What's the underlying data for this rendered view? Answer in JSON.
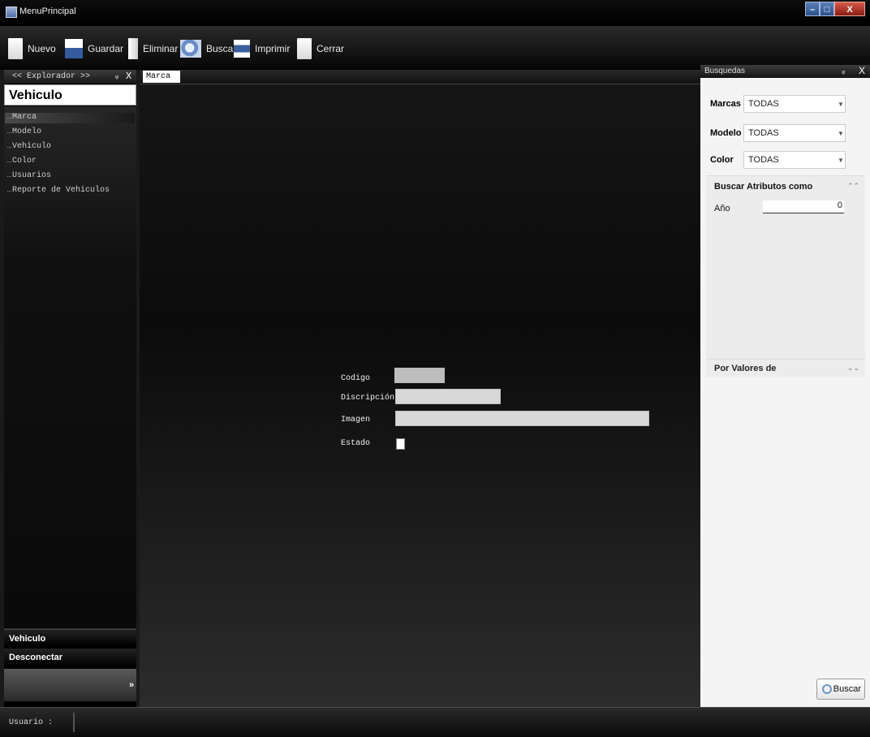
{
  "window": {
    "title": "MenuPrincipal",
    "min_label": "–",
    "max_label": "□",
    "close_label": "X"
  },
  "toolbar": {
    "nuevo": "Nuevo",
    "guardar": "Guardar",
    "eliminar": "Eliminar",
    "buscar": "Buscar",
    "imprimir": "Imprimir",
    "cerrar": "Cerrar"
  },
  "explorer": {
    "header": "<< Explorador >>",
    "pin": "ᵩ",
    "close": "X",
    "title": "Vehiculo",
    "items": [
      "Marca",
      "Modelo",
      "Vehiculo",
      "Color",
      "Usuarios",
      "Reporte de Vehiculos"
    ],
    "nav": [
      "Vehiculo",
      "Desconectar"
    ],
    "chevron": "»"
  },
  "main": {
    "tab": "Marca",
    "form": {
      "codigo_label": "Codigo",
      "descripcion_label": "Discripción",
      "imagen_label": "Imagen",
      "estado_label": "Estado",
      "codigo_value": "",
      "descripcion_value": "",
      "imagen_value": ""
    }
  },
  "search": {
    "header": "Busquedas",
    "pin": "ᵩ",
    "close": "X",
    "filters": [
      {
        "label": "Marcas",
        "value": "TODAS"
      },
      {
        "label": "Modelo",
        "value": "TODAS"
      },
      {
        "label": "Color",
        "value": "TODAS"
      }
    ],
    "group_atributos": "Buscar Atributos como",
    "anio_label": "Año",
    "anio_value": "0",
    "group_valores": "Por Valores de",
    "buscar_button": "Buscar"
  },
  "status": {
    "usuario": "Usuario :"
  },
  "icons": [
    "window-app-icon",
    "new-doc-icon",
    "save-icon",
    "delete-icon",
    "search-icon",
    "print-icon",
    "close-doc-icon",
    "pin-icon",
    "close-icon",
    "chevron-down-icon",
    "collapse-icon",
    "expand-icon",
    "magnifier-icon"
  ]
}
